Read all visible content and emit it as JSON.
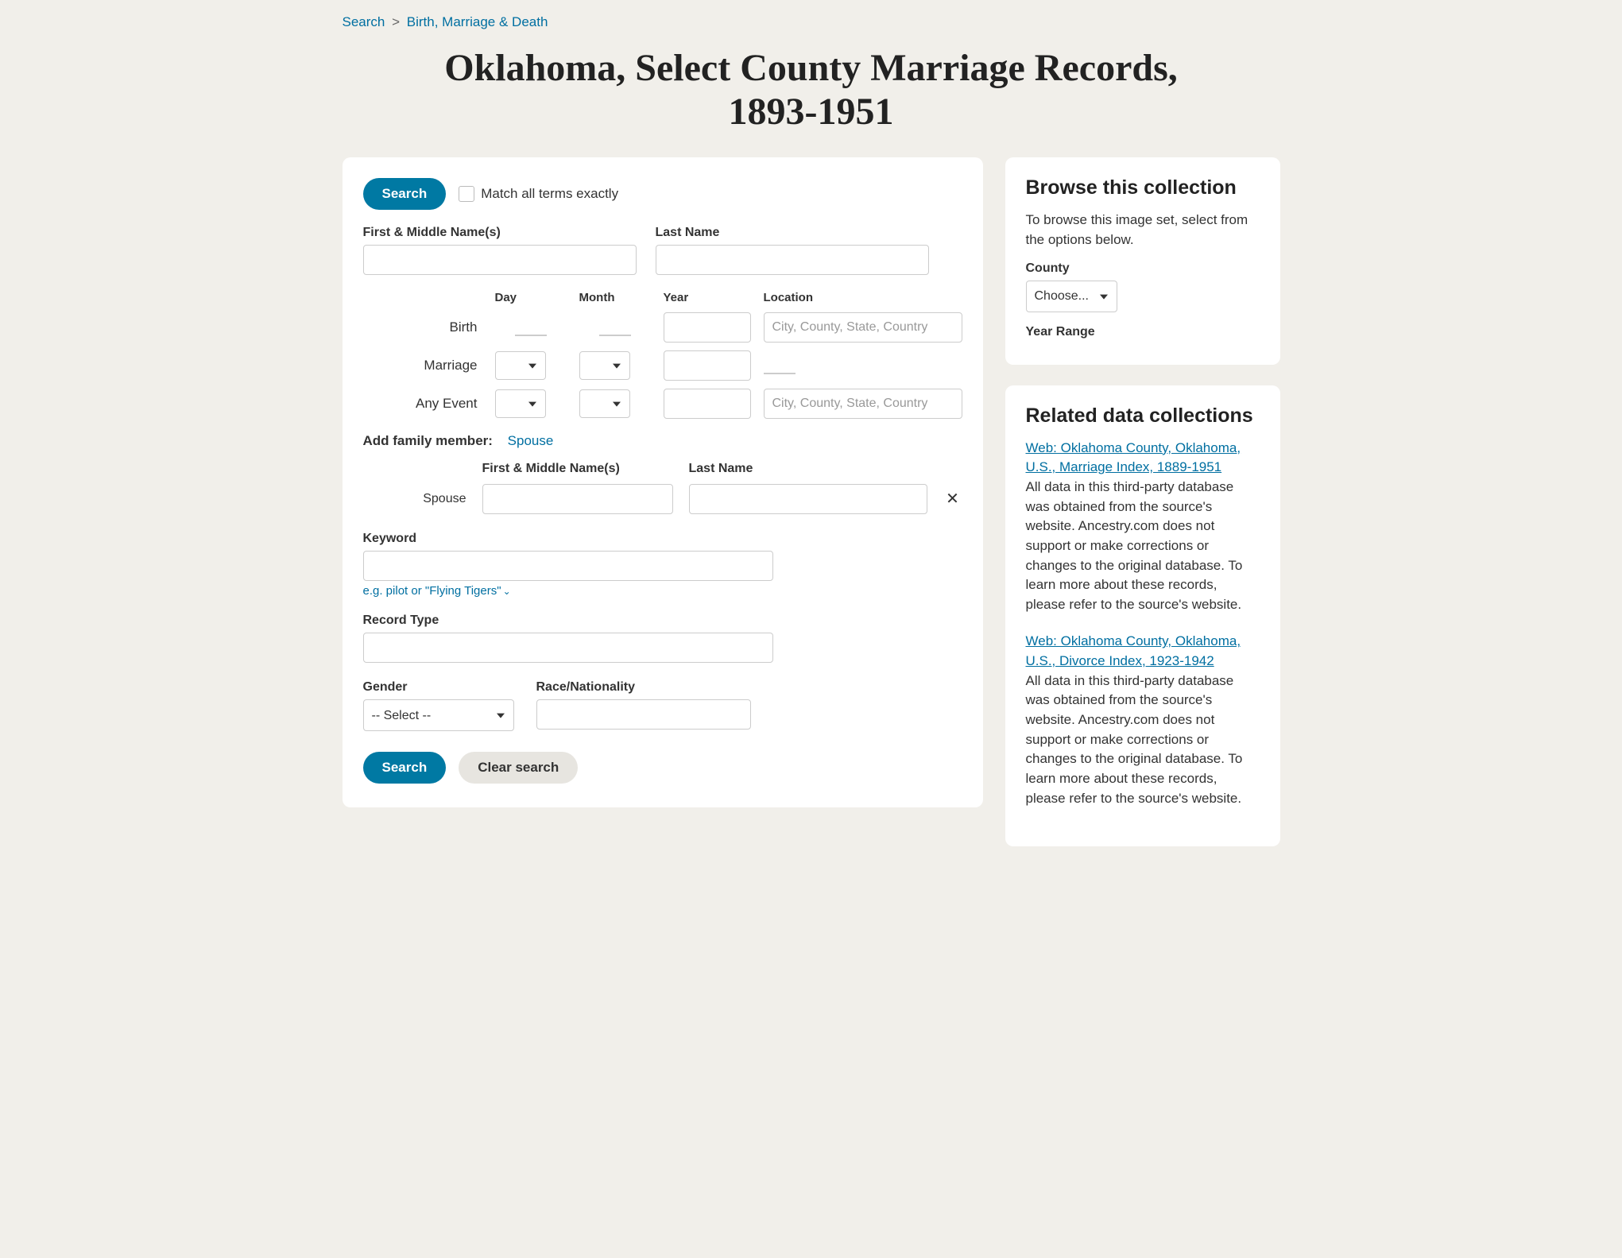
{
  "breadcrumb": {
    "root": "Search",
    "sep": ">",
    "cat": "Birth, Marriage & Death"
  },
  "page_title": "Oklahoma, Select County Marriage Records, 1893-1951",
  "form": {
    "search_btn": "Search",
    "match_exact": "Match all terms exactly",
    "first_label": "First & Middle Name(s)",
    "last_label": "Last Name",
    "cols": {
      "day": "Day",
      "month": "Month",
      "year": "Year",
      "location": "Location"
    },
    "rows": {
      "birth": "Birth",
      "marriage": "Marriage",
      "any": "Any Event"
    },
    "loc_placeholder": "City, County, State, Country",
    "family_label": "Add family member:",
    "family_spouse_link": "Spouse",
    "spouse_row_label": "Spouse",
    "spouse_first_label": "First & Middle Name(s)",
    "spouse_last_label": "Last Name",
    "keyword_label": "Keyword",
    "keyword_hint": "e.g. pilot or \"Flying Tigers\"",
    "record_type_label": "Record Type",
    "gender_label": "Gender",
    "gender_placeholder": "-- Select --",
    "race_label": "Race/Nationality",
    "clear_btn": "Clear search"
  },
  "browse": {
    "title": "Browse this collection",
    "desc": "To browse this image set, select from the options below.",
    "county_label": "County",
    "county_placeholder": "Choose...",
    "year_range_label": "Year Range"
  },
  "related": {
    "title": "Related data collections",
    "items": [
      {
        "link": "Web: Oklahoma County, Oklahoma, U.S., Marriage Index, 1889-1951",
        "desc": "All data in this third-party database was obtained from the source's website. Ancestry.com does not support or make corrections or changes to the original database. To learn more about these records, please refer to the source's website."
      },
      {
        "link": "Web: Oklahoma County, Oklahoma, U.S., Divorce Index, 1923-1942",
        "desc": "All data in this third-party database was obtained from the source's website. Ancestry.com does not support or make corrections or changes to the original database. To learn more about these records, please refer to the source's website."
      }
    ]
  }
}
